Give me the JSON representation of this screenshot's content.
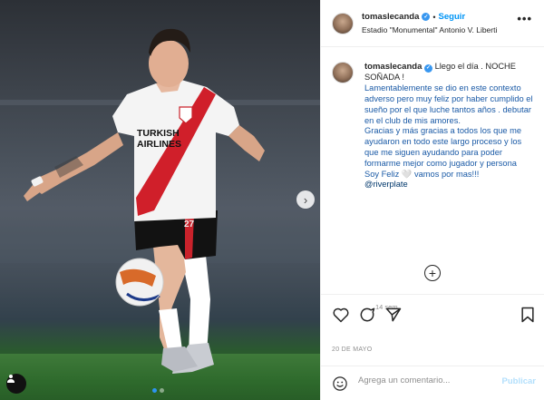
{
  "post": {
    "username": "tomaslecanda",
    "follow_label": "Seguir",
    "location": "Estadio \"Monumental\" Antonio V. Liberti",
    "more_label": "•••",
    "jersey_sponsor": "TURKISH AIRLINES"
  },
  "caption": {
    "username": "tomaslecanda",
    "lines": [
      "Llego el día . NOCHE SOÑADA !",
      "Lamentablemente se dio en este contexto adverso pero muy feliz por haber cumplido el sueño por el que luche tantos años . debutar en el club de mis amores.",
      "Gracias y más gracias a todos los que me ayudaron en todo este largo proceso y los que me siguen ayudando para poder formarme mejor como jugador y persona",
      "Soy Feliz 🤍 vamos por mas!!!"
    ],
    "mention": "@riverplate",
    "time_ago": "14 sem"
  },
  "meta": {
    "date": "20 DE MAYO"
  },
  "comment": {
    "placeholder": "Agrega un comentario...",
    "publish_label": "Publicar"
  },
  "icons": {
    "like": "heart-icon",
    "comment": "comment-icon",
    "share": "paper-plane-icon",
    "save": "bookmark-icon",
    "emoji": "smiley-icon",
    "load_more": "plus-circle-icon",
    "carousel_next": "chevron-right-icon",
    "tagged_users": "user-tag-icon"
  },
  "colors": {
    "link_blue": "#0095f6",
    "verified_blue": "#3897f0",
    "muted": "#8e8e8e"
  },
  "carousel": {
    "current": 1,
    "total": 2
  }
}
